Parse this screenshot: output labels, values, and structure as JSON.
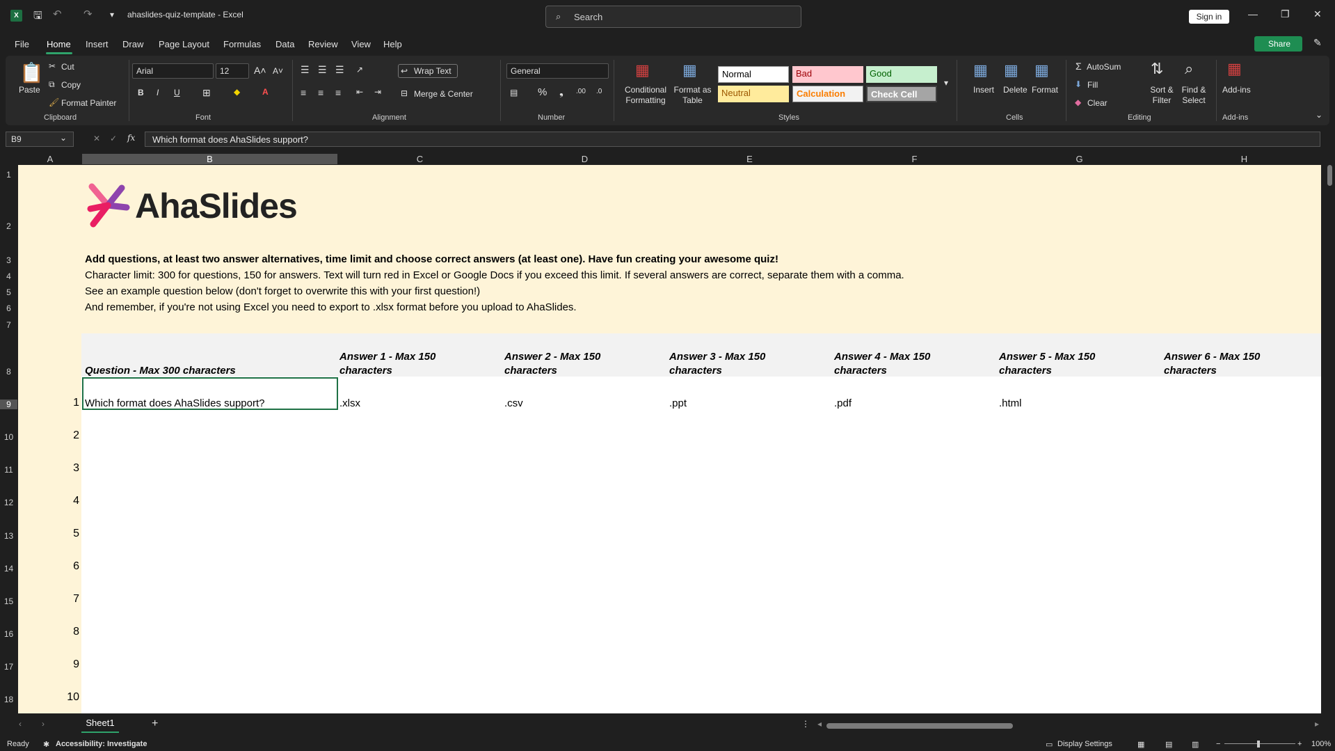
{
  "window": {
    "title": "ahaslides-quiz-template - Excel",
    "search_placeholder": "Search",
    "sign_in": "Sign in"
  },
  "menu": [
    "File",
    "Home",
    "Insert",
    "Draw",
    "Page Layout",
    "Formulas",
    "Data",
    "Review",
    "View",
    "Help"
  ],
  "share_label": "Share",
  "ribbon": {
    "clipboard": {
      "paste": "Paste",
      "cut": "Cut",
      "copy": "Copy",
      "format_painter": "Format Painter",
      "group": "Clipboard"
    },
    "font": {
      "name": "Arial",
      "size": "12",
      "group": "Font"
    },
    "alignment": {
      "wrap_text": "Wrap Text",
      "merge_center": "Merge & Center",
      "group": "Alignment"
    },
    "number": {
      "format": "General",
      "group": "Number"
    },
    "styles": {
      "conditional": "Conditional Formatting",
      "format_table": "Format as Table",
      "normal": "Normal",
      "bad": "Bad",
      "good": "Good",
      "neutral": "Neutral",
      "calculation": "Calculation",
      "check_cell": "Check Cell",
      "group": "Styles"
    },
    "cells": {
      "insert": "Insert",
      "delete": "Delete",
      "format": "Format",
      "group": "Cells"
    },
    "editing": {
      "autosum": "AutoSum",
      "fill": "Fill",
      "clear": "Clear",
      "sort": "Sort & Filter",
      "find": "Find & Select",
      "group": "Editing"
    },
    "addins": {
      "label": "Add-ins",
      "group": "Add-ins"
    }
  },
  "formula_bar": {
    "name_box": "B9",
    "formula": "Which format does AhaSlides support?"
  },
  "columns": [
    "A",
    "B",
    "C",
    "D",
    "E",
    "F",
    "G",
    "H"
  ],
  "rows": [
    "1",
    "2",
    "3",
    "4",
    "5",
    "6",
    "7",
    "8",
    "9",
    "10",
    "11",
    "12",
    "13",
    "14",
    "15",
    "16",
    "17",
    "18"
  ],
  "sheet": {
    "logo_text": "AhaSlides",
    "intro_bold": "Add questions, at least two answer alternatives, time limit and choose correct answers (at least one). Have fun creating your awesome quiz!",
    "intro_2": "Character limit: 300 for questions, 150 for answers. Text will turn red in Excel or Google Docs if you exceed this limit. If several answers are correct, separate them with a comma.",
    "intro_3": "See an example question below (don't forget to overwrite this with your first question!)",
    "intro_4": "And remember, if you're not using Excel you need to export to .xlsx format before you upload to AhaSlides.",
    "headers": {
      "question": "Question - Max 300 characters",
      "answers": [
        [
          "Answer 1 - Max 150",
          "characters"
        ],
        [
          "Answer 2 - Max 150",
          "characters"
        ],
        [
          "Answer 3 - Max 150",
          "characters"
        ],
        [
          "Answer 4 - Max 150",
          "characters"
        ],
        [
          "Answer 5 - Max 150",
          "characters"
        ],
        [
          "Answer 6 - Max 150",
          "characters"
        ]
      ]
    },
    "question_row": {
      "number": "1",
      "question": "Which format does AhaSlides support?",
      "answers": [
        ".xlsx",
        ".csv",
        ".ppt",
        ".pdf",
        ".html"
      ]
    },
    "numbers": [
      "2",
      "3",
      "4",
      "5",
      "6",
      "7",
      "8",
      "9",
      "10"
    ]
  },
  "sheet_tab": "Sheet1",
  "status": {
    "ready": "Ready",
    "accessibility": "Accessibility: Investigate",
    "display_settings": "Display Settings",
    "zoom": "100%"
  },
  "colors": {
    "accent": "#2fa36b",
    "cream": "#fef4d8",
    "share": "#1e8d52"
  }
}
